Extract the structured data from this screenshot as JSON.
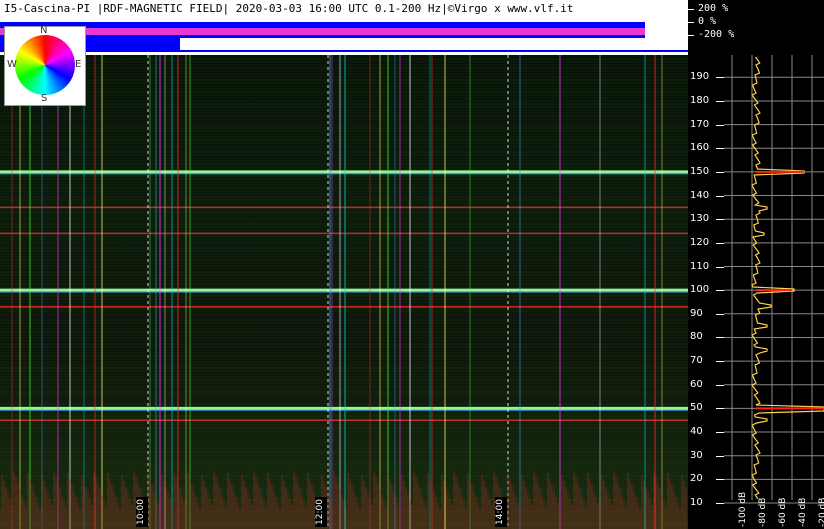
{
  "header": {
    "title": "I5-Cascina-PI |RDF-MAGNETIC FIELD| 2020-03-03 16:00 UTC 0.1-200 Hz|©Virgo x www.vlf.it"
  },
  "percent_scale": [
    "200 %",
    "0 %",
    "-200 %"
  ],
  "compass": {
    "north": "N",
    "south": "S",
    "east": "E",
    "west": "W"
  },
  "freq_axis": [
    "190",
    "180",
    "170",
    "160",
    "150",
    "140",
    "130",
    "120",
    "110",
    "100",
    "90",
    "80",
    "70",
    "60",
    "50",
    "40",
    "30",
    "20",
    "10"
  ],
  "time_labels": [
    "10:00",
    "12:00",
    "14:00"
  ],
  "db_labels": [
    "-100 dB",
    "-80 dB",
    "-60 dB",
    "-40 dB",
    "-20 dB"
  ],
  "colors": {
    "header_blue": "#0000ff",
    "header_magenta": "#ff3fd0",
    "line_green": "#7dff7d",
    "line_red": "#ff3030",
    "spectrum_trace": "#ffd24a"
  }
}
